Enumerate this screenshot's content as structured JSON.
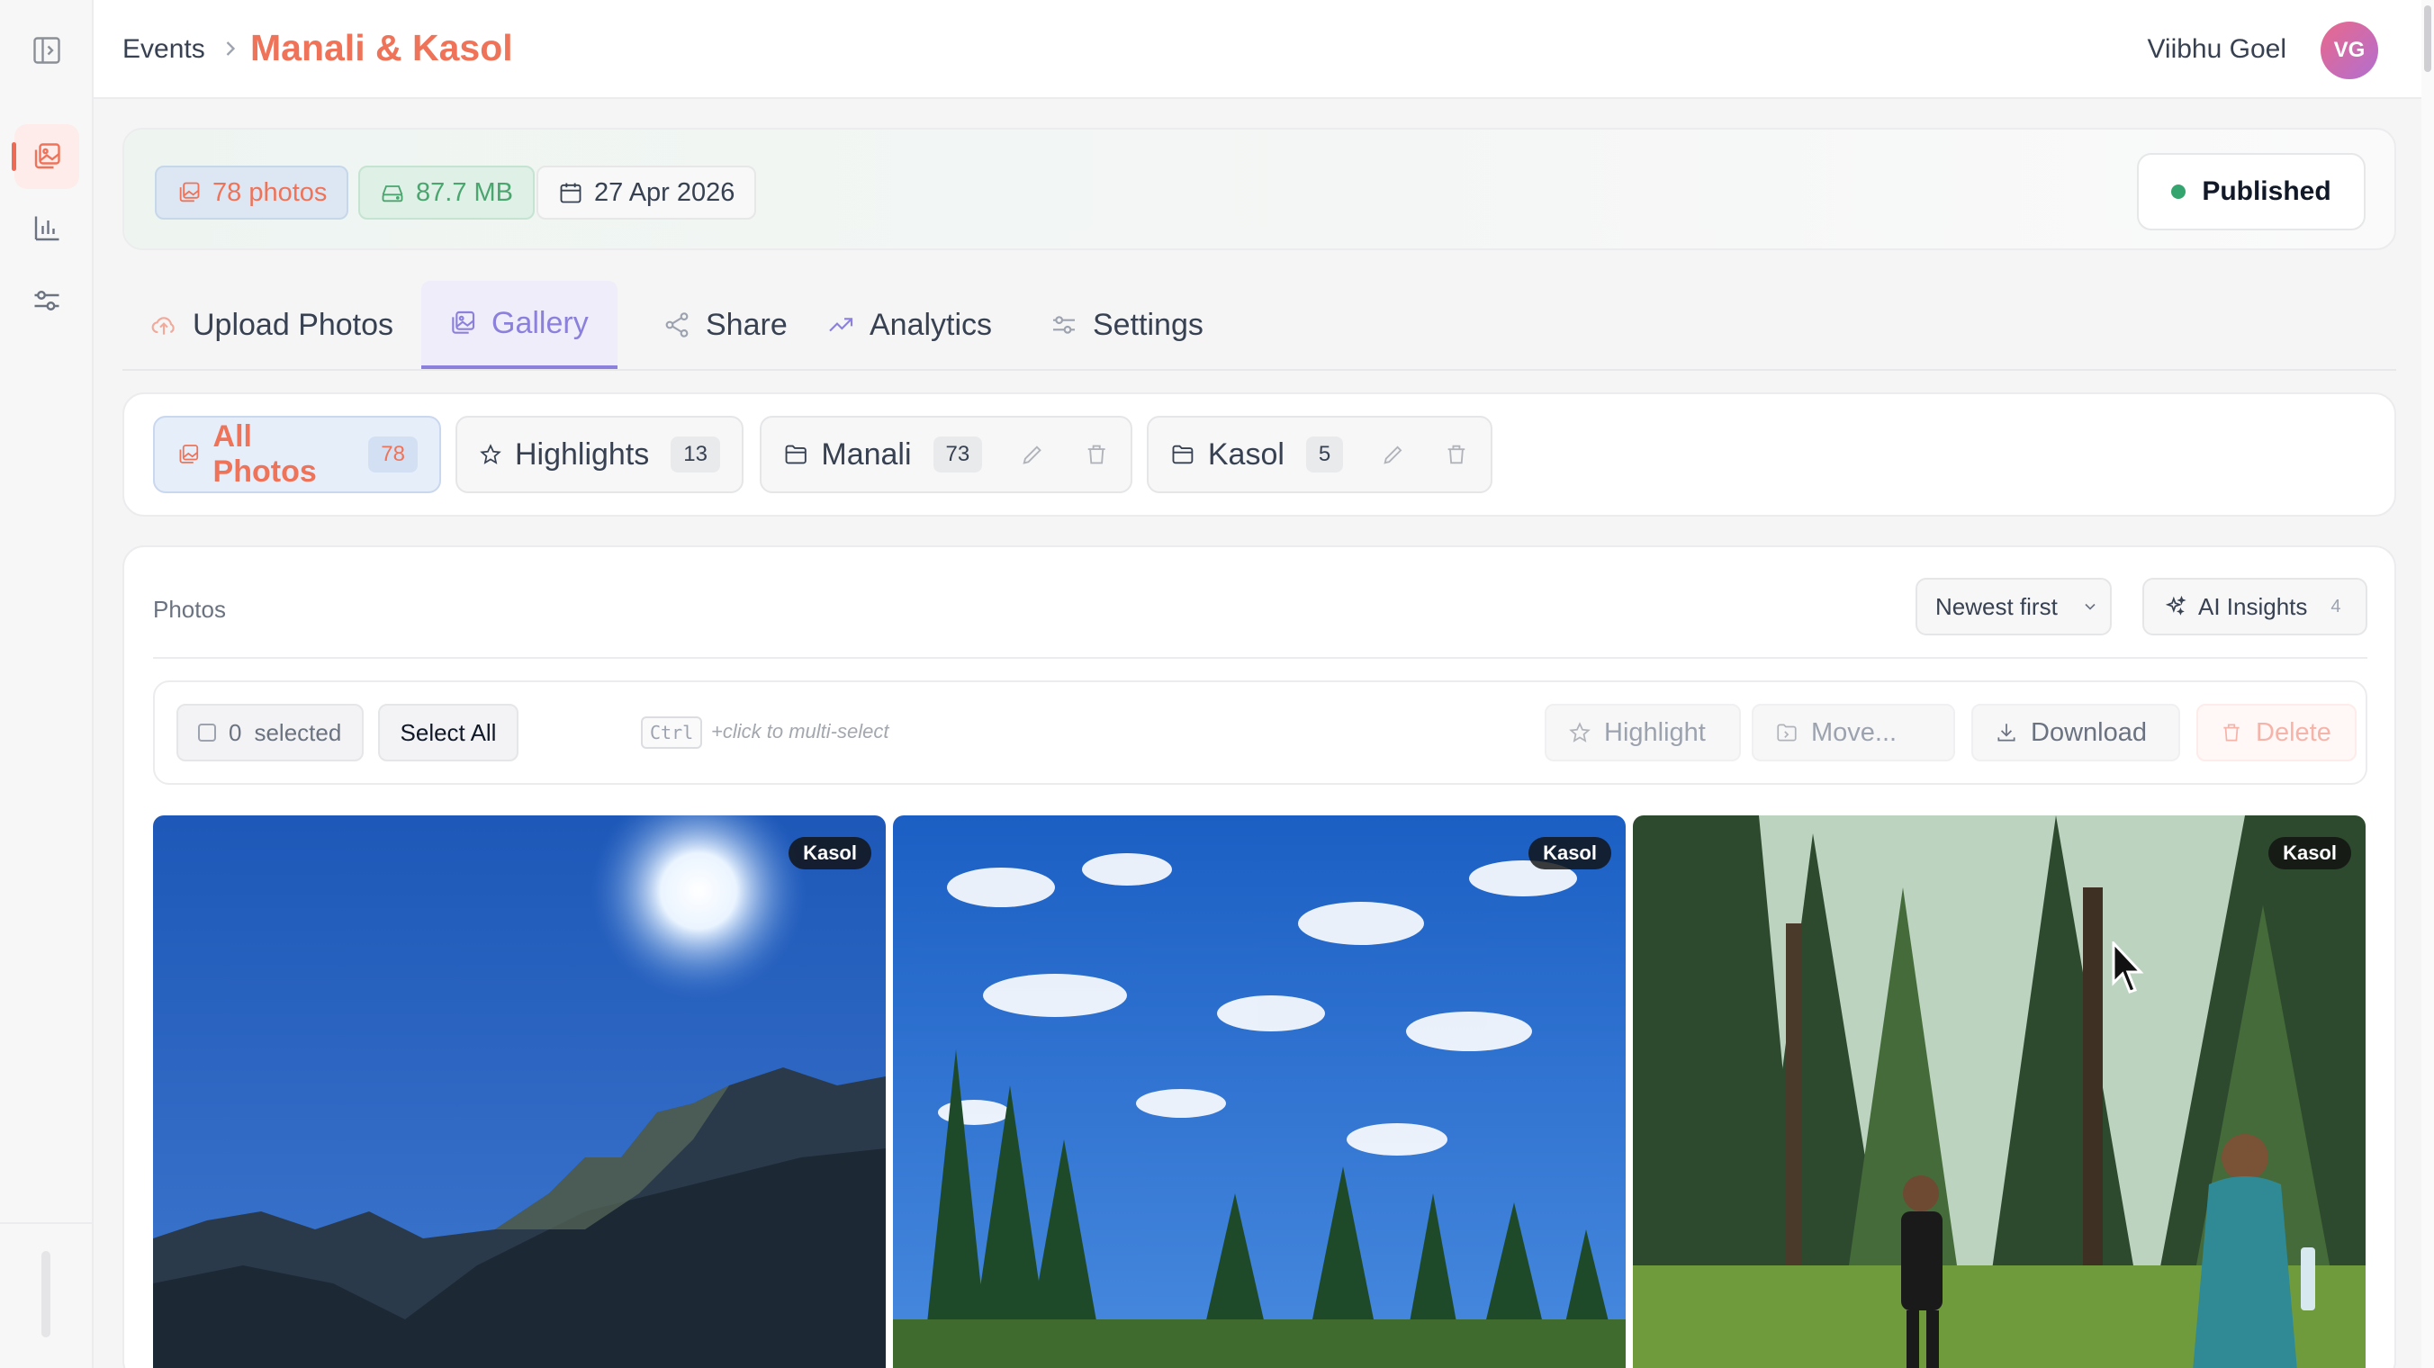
{
  "header": {
    "breadcrumb_root": "Events",
    "event_title": "Manali & Kasol",
    "user_name": "Viibhu Goel",
    "user_initials": "VG"
  },
  "event_info": {
    "photos": "78 photos",
    "size": "87.7 MB",
    "date": "27 Apr 2026",
    "status": "Published"
  },
  "tabs": [
    {
      "label": "Upload Photos",
      "icon": "cloud-upload-icon"
    },
    {
      "label": "Gallery",
      "icon": "gallery-icon",
      "active": true
    },
    {
      "label": "Share",
      "icon": "share-icon"
    },
    {
      "label": "Analytics",
      "icon": "trend-icon"
    },
    {
      "label": "Settings",
      "icon": "sliders-icon"
    }
  ],
  "albums": [
    {
      "label": "All Photos",
      "count": "78",
      "icon": "gallery-icon",
      "active": true
    },
    {
      "label": "Highlights",
      "count": "13",
      "icon": "star-icon"
    },
    {
      "label": "Manali",
      "count": "73",
      "icon": "folder-icon"
    },
    {
      "label": "Kasol",
      "count": "5",
      "icon": "folder-icon"
    }
  ],
  "photos": {
    "label": "Photos",
    "sort": "Newest first",
    "insights_label": "AI Insights",
    "insights_count": "4"
  },
  "toolbar": {
    "selected_count": "0",
    "selected_label": "selected",
    "select_all": "Select  All",
    "kbd": "Ctrl",
    "hint": "+click to multi-select",
    "highlight": "Highlight",
    "move": "Move...",
    "download": "Download",
    "delete": "Delete"
  },
  "tiles": [
    {
      "album": "Kasol",
      "scene": "mountain sky with sun"
    },
    {
      "album": "Kasol",
      "scene": "blue sky with clouds over pine trees"
    },
    {
      "album": "Kasol",
      "scene": "two hikers in pine forest"
    }
  ],
  "colors": {
    "accent": "#ee7359",
    "gallery_accent": "#8b80dc",
    "published_dot": "#34a56f"
  }
}
